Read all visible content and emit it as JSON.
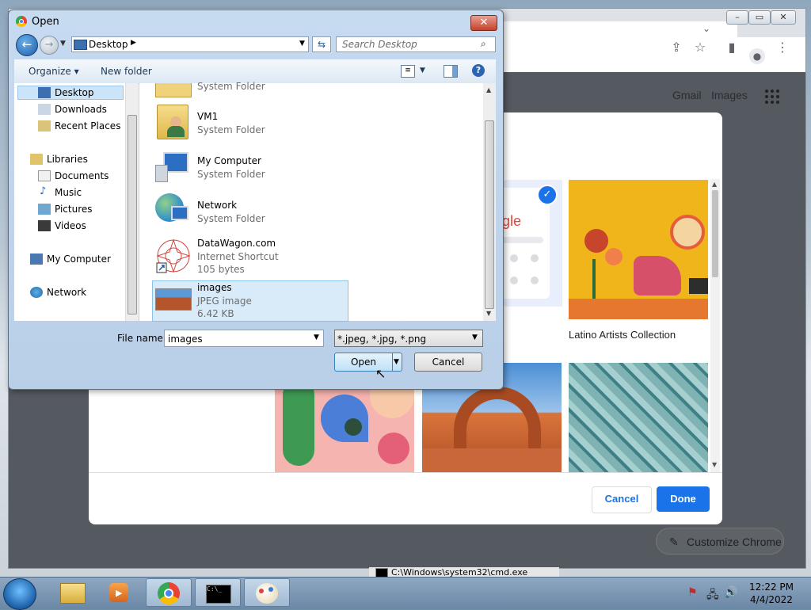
{
  "chrome": {
    "header_links": {
      "gmail": "Gmail",
      "images": "Images"
    },
    "customize_label": "Customize Chrome",
    "modal": {
      "tile_label": "Latino Artists Collection",
      "cancel_label": "Cancel",
      "done_label": "Done"
    }
  },
  "dialog": {
    "title": "Open",
    "address": "Desktop",
    "search_placeholder": "Search Desktop",
    "toolbar": {
      "organize": "Organize",
      "new_folder": "New folder"
    },
    "nav": {
      "favorites": [
        {
          "label": "Desktop"
        },
        {
          "label": "Downloads"
        },
        {
          "label": "Recent Places"
        }
      ],
      "libraries_label": "Libraries",
      "libraries": [
        {
          "label": "Documents"
        },
        {
          "label": "Music"
        },
        {
          "label": "Pictures"
        },
        {
          "label": "Videos"
        }
      ],
      "computer": "My Computer",
      "network": "Network"
    },
    "files": [
      {
        "name": "",
        "sub": "System Folder"
      },
      {
        "name": "VM1",
        "sub": "System Folder"
      },
      {
        "name": "My Computer",
        "sub": "System Folder"
      },
      {
        "name": "Network",
        "sub": "System Folder"
      },
      {
        "name": "DataWagon.com",
        "sub": "Internet Shortcut",
        "size": "105 bytes"
      },
      {
        "name": "images",
        "sub": "JPEG image",
        "size": "6.42 KB"
      }
    ],
    "file_name_label": "File name:",
    "file_name_value": "images",
    "file_type_value": "*.jpeg, *.jpg, *.png",
    "open_label": "Open",
    "cancel_label": "Cancel"
  },
  "taskbar": {
    "cmd_title": "C:\\Windows\\system32\\cmd.exe",
    "time": "12:22 PM",
    "date": "4/4/2022"
  },
  "colors": {
    "accent": "#1a73e8",
    "dialog_frame": "#b9cfe8",
    "selection": "#d9ebf9"
  }
}
